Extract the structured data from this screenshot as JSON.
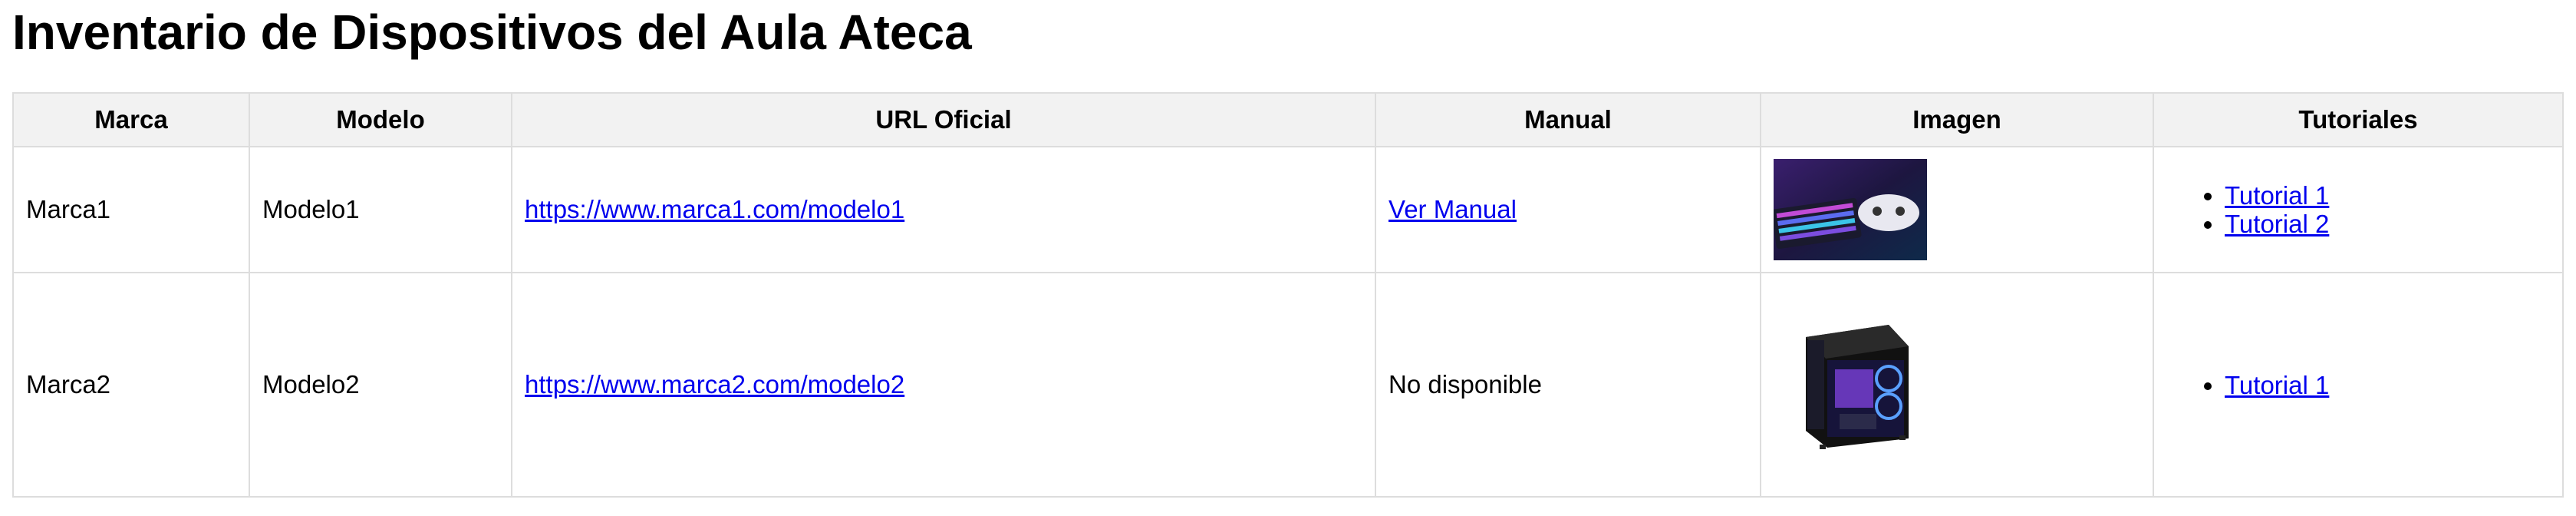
{
  "page": {
    "title": "Inventario de Dispositivos del Aula Ateca"
  },
  "table": {
    "headers": [
      "Marca",
      "Modelo",
      "URL Oficial",
      "Manual",
      "Imagen",
      "Tutoriales"
    ],
    "rows": [
      {
        "marca": "Marca1",
        "modelo": "Modelo1",
        "url": "https://www.marca1.com/modelo1",
        "manual": "Ver Manual",
        "image": "gaming-keyboard-controller-photo",
        "tutorials": [
          "Tutorial 1",
          "Tutorial 2"
        ]
      },
      {
        "marca": "Marca2",
        "modelo": "Modelo2",
        "url": "https://www.marca2.com/modelo2",
        "manual": "No disponible",
        "image": "pc-tower-case-photo",
        "tutorials": [
          "Tutorial 1"
        ]
      }
    ]
  },
  "colors": {
    "link": "#0000ee",
    "header_bg": "#f2f2f2",
    "border": "#dddddd"
  }
}
